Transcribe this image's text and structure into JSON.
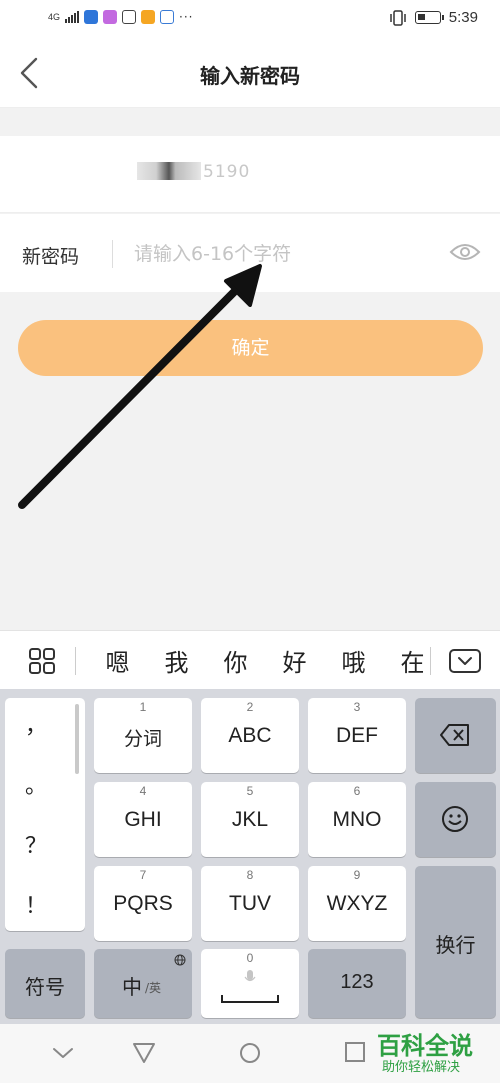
{
  "status_bar": {
    "network": "4G",
    "time": "5:39",
    "more": "···",
    "battery_level": 0.35
  },
  "header": {
    "title": "输入新密码"
  },
  "phone": {
    "masked_number": "5190"
  },
  "password": {
    "label": "新密码",
    "placeholder": "请输入6-16个字符",
    "value": ""
  },
  "confirm_label": "确定",
  "candidates": [
    "嗯",
    "我",
    "你",
    "好",
    "哦",
    "在"
  ],
  "keyboard": {
    "punctuation": [
      "，",
      "。",
      "？",
      "！"
    ],
    "keys": [
      {
        "num": "1",
        "label": "分词"
      },
      {
        "num": "2",
        "label": "ABC"
      },
      {
        "num": "3",
        "label": "DEF"
      },
      {
        "num": "4",
        "label": "GHI"
      },
      {
        "num": "5",
        "label": "JKL"
      },
      {
        "num": "6",
        "label": "MNO"
      },
      {
        "num": "7",
        "label": "PQRS"
      },
      {
        "num": "8",
        "label": "TUV"
      },
      {
        "num": "9",
        "label": "WXYZ"
      }
    ],
    "symbol": "符号",
    "lang_main": "中",
    "lang_sub": "/英",
    "space_num": "0",
    "digits": "123",
    "enter": "换行"
  },
  "watermark": {
    "title": "百科全说",
    "subtitle": "助你轻松解决"
  },
  "colors": {
    "accent": "#fac17e",
    "keyboard_bg": "#d6d8de",
    "function_key": "#aeb3bd",
    "watermark": "#2ea043"
  },
  "icons": [
    "back-icon",
    "eye-icon",
    "grid-icon",
    "collapse-keyboard-icon",
    "backspace-icon",
    "emoji-icon",
    "mic-icon",
    "globe-icon",
    "nav-back-icon",
    "nav-home-icon",
    "nav-recents-icon",
    "nav-hide-icon"
  ]
}
